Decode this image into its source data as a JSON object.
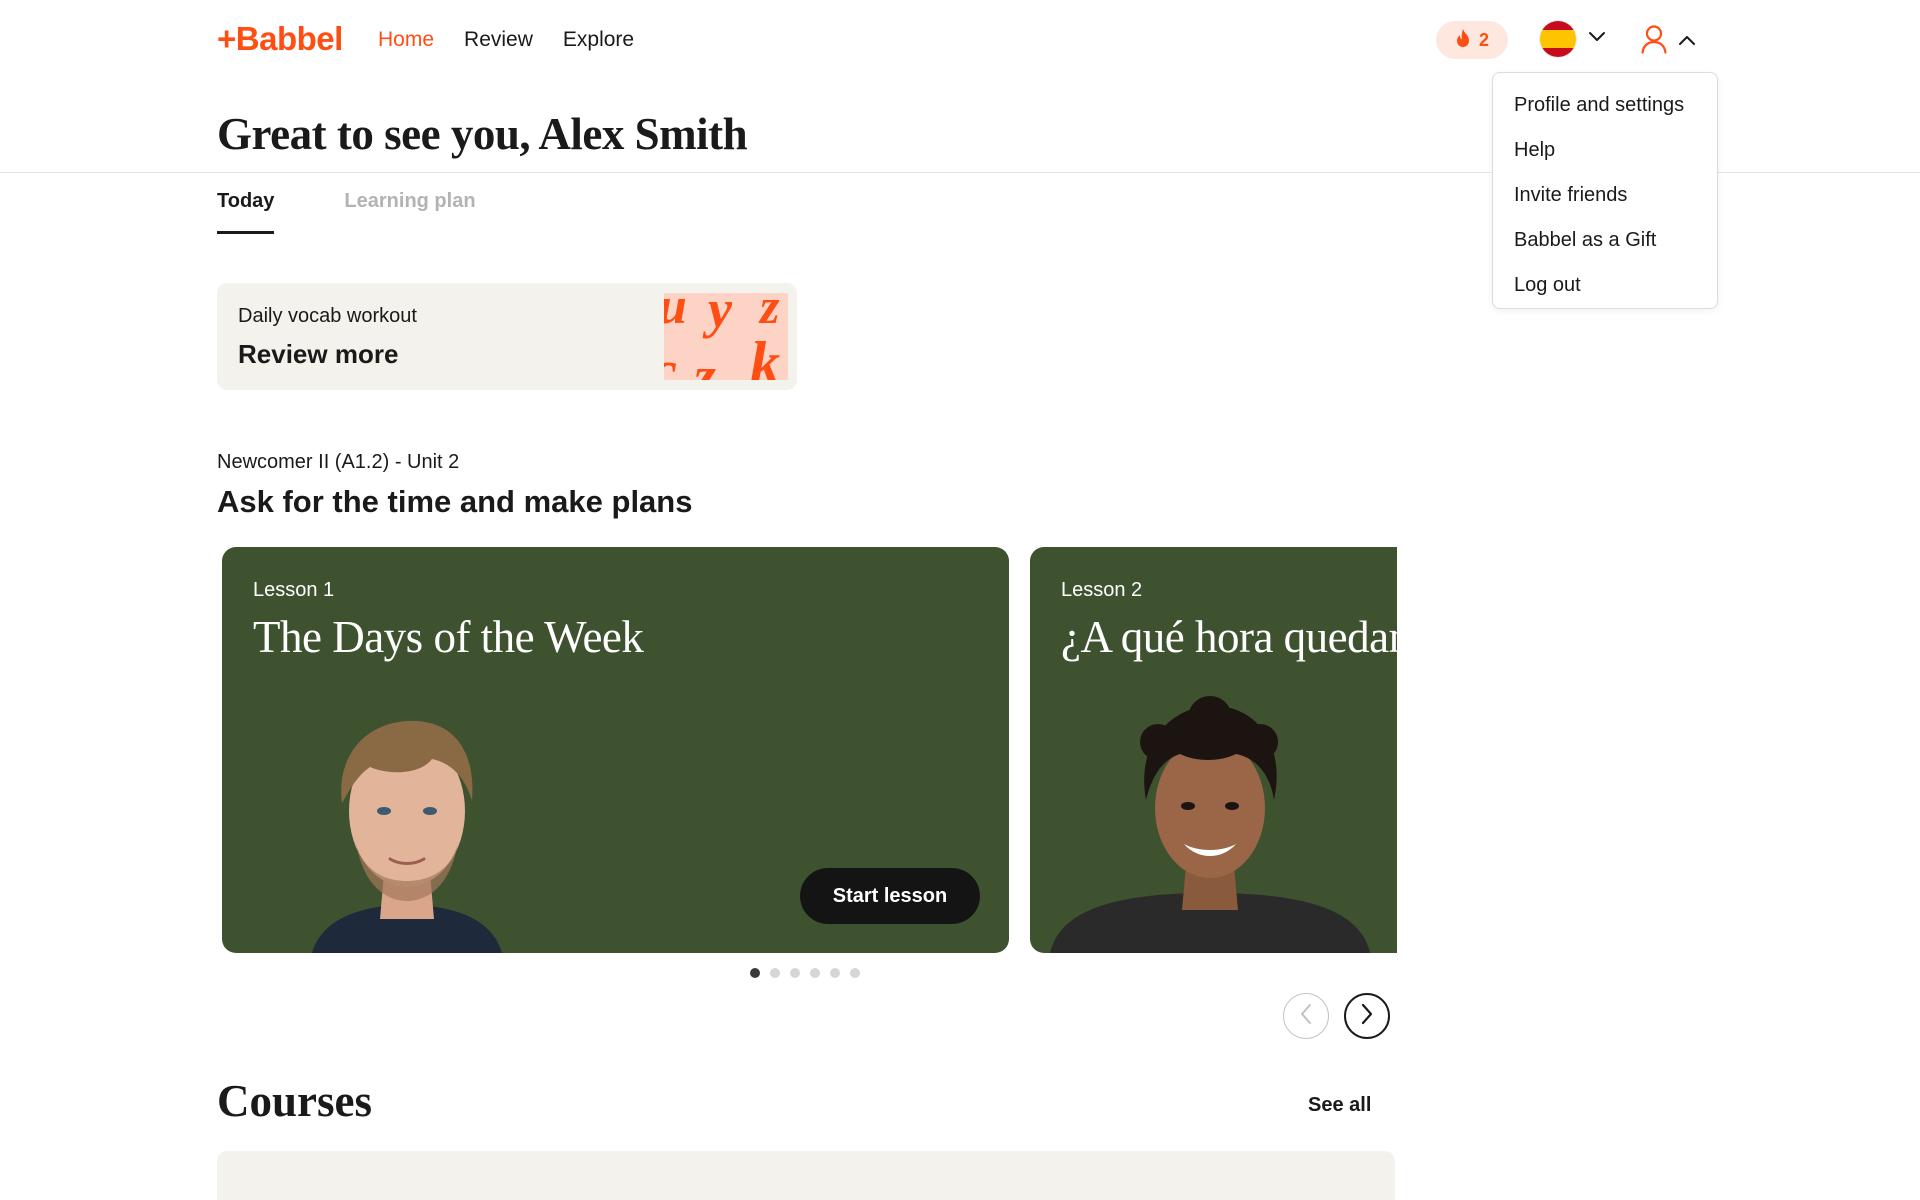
{
  "header": {
    "logo_text": "+Babbel",
    "nav": [
      {
        "label": "Home",
        "active": true
      },
      {
        "label": "Review",
        "active": false
      },
      {
        "label": "Explore",
        "active": false
      }
    ],
    "streak_count": "2",
    "language_flag": "spain-flag-icon"
  },
  "profile_menu": {
    "items": [
      "Profile and settings",
      "Help",
      "Invite friends",
      "Babbel as a Gift",
      "Log out"
    ]
  },
  "greeting": "Great to see you, Alex Smith",
  "tabs": [
    {
      "label": "Today",
      "active": true
    },
    {
      "label": "Learning plan",
      "active": false
    }
  ],
  "vocab_card": {
    "subtitle": "Daily vocab workout",
    "title": "Review more"
  },
  "unit": {
    "subtitle": "Newcomer II (A1.2) - Unit 2",
    "title": "Ask for the time and make plans"
  },
  "lessons": [
    {
      "number": "Lesson 1",
      "title": "The Days of the Week",
      "cta": "Start lesson"
    },
    {
      "number": "Lesson 2",
      "title": "¿A qué hora quedamos?"
    }
  ],
  "carousel": {
    "total_dots": 6,
    "active_index": 0
  },
  "courses": {
    "title": "Courses",
    "see_all": "See all"
  },
  "colors": {
    "brand": "#ff4e14",
    "lesson_card_bg": "#3f5230",
    "card_bg": "#f4f2ec"
  }
}
